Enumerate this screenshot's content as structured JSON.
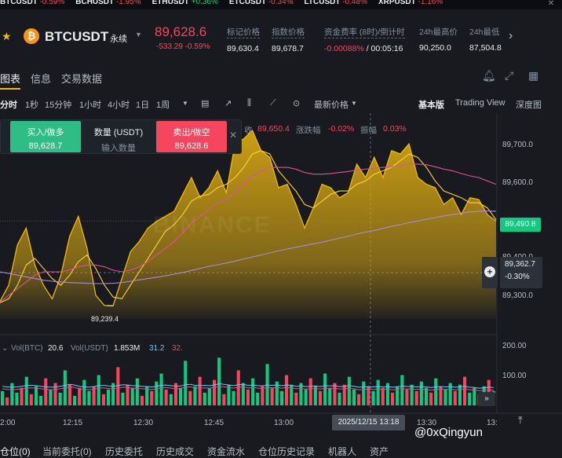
{
  "ticker": [
    {
      "sym": "BTCUSDT",
      "chg": "-0.59%",
      "dir": "neg"
    },
    {
      "sym": "BCHUSDT",
      "chg": "-1.95%",
      "dir": "neg"
    },
    {
      "sym": "ETHUSDT",
      "chg": "+0.36%",
      "dir": "pos"
    },
    {
      "sym": "ETCUSDT",
      "chg": "-0.34%",
      "dir": "neg"
    },
    {
      "sym": "LTCUSDT",
      "chg": "-0.48%",
      "dir": "neg"
    },
    {
      "sym": "XRPUSDT",
      "chg": "-1.16%",
      "dir": "neg"
    }
  ],
  "header": {
    "pair": "BTCUSDT",
    "perp": "永续",
    "price": "89,628.6",
    "change": "-533.29 -0.59%",
    "stats": [
      {
        "label": "标记价格",
        "value": "89,630.4"
      },
      {
        "label": "指数价格",
        "value": "89,678.7"
      },
      {
        "label": "资金费率 (8时)/倒计时",
        "value_neg": "-0.00088%",
        "value": " / 00:05:16"
      },
      {
        "label": "24h最高价",
        "value": "90,250.0"
      },
      {
        "label": "24h最低",
        "value": "87,504.8"
      }
    ]
  },
  "tabs": [
    "图表",
    "信息",
    "交易数据"
  ],
  "toolbar": {
    "intervals": [
      "分时",
      "1秒",
      "15分钟",
      "1小时",
      "4小时",
      "1日",
      "1周"
    ],
    "price_type": "最新价格",
    "views": [
      "基本版",
      "Trading View",
      "深度图"
    ]
  },
  "order_box": {
    "buy_label": "买入/做多",
    "buy_price": "89,628.7",
    "qty_label": "数量 (USDT)",
    "qty_placeholder": "输入数量",
    "sell_label": "卖出/做空",
    "sell_price": "89,628.6"
  },
  "ohlc": {
    "close_label": "收",
    "close": "89,650.4",
    "chg_label": "涨跌幅",
    "chg": "-0.02%",
    "amp_label": "振幅",
    "amp": "0.03%"
  },
  "watermark": "BINANCE",
  "price_axis": {
    "labels": [
      "89,700.0",
      "89,600.0",
      "89,400.0",
      "89,300.0"
    ],
    "current_tag": "89,490.8",
    "cross_tag": "89,362.7",
    "cross_pct": "-0.30%",
    "low_label": "89,239.4"
  },
  "volume": {
    "vol_btc_label": "Vol(BTC)",
    "vol_btc": "20.6",
    "vol_usdt_label": "Vol(USDT)",
    "vol_usdt": "1.853M",
    "ma1": "31.2",
    "ma2": "32.",
    "axis": [
      "200.00",
      "100.00"
    ]
  },
  "time_axis": {
    "labels": [
      "2:00",
      "12:15",
      "12:30",
      "12:45",
      "13:00",
      "13:30",
      "13:"
    ],
    "cross": "2025/12/15 13:18"
  },
  "bottom_tabs": [
    "仓位(0)",
    "当前委托(0)",
    "历史委托",
    "历史成交",
    "资金流水",
    "仓位历史记录",
    "机器人",
    "资产"
  ],
  "credit": "@0xQingyun",
  "colors": {
    "up": "#0ecb81",
    "down": "#f6465d",
    "accent": "#f0b90b",
    "area": "#d4a514"
  },
  "chart_data": {
    "type": "area",
    "y_range": [
      89200,
      89760
    ],
    "price": [
      89252,
      89300,
      89420,
      89470,
      89360,
      89300,
      89260,
      89330,
      89445,
      89505,
      89410,
      89270,
      89240,
      89239.4,
      89320,
      89400,
      89430,
      89470,
      89490,
      89505,
      89520,
      89570,
      89620,
      89560,
      89590,
      89640,
      89575,
      89720,
      89735,
      89760,
      89700,
      89680,
      89590,
      89600,
      89540,
      89470,
      89530,
      89600,
      89590,
      89560,
      89575,
      89660,
      89620,
      89680,
      89620,
      89700,
      89690,
      89720,
      89620,
      89600,
      89590,
      89540,
      89560,
      89510,
      89560,
      89555,
      89510,
      89490.8
    ],
    "ma_fast": [
      89248,
      89260,
      89300,
      89360,
      89380,
      89350,
      89320,
      89300,
      89330,
      89370,
      89390,
      89350,
      89300,
      89265,
      89260,
      89300,
      89340,
      89380,
      89420,
      89460,
      89480,
      89510,
      89550,
      89565,
      89570,
      89590,
      89600,
      89620,
      89650,
      89690,
      89700,
      89690,
      89640,
      89610,
      89580,
      89540,
      89530,
      89550,
      89570,
      89580,
      89580,
      89600,
      89610,
      89630,
      89640,
      89650,
      89670,
      89690,
      89680,
      89650,
      89610,
      89580,
      89570,
      89560,
      89545,
      89545,
      89530,
      89495
    ],
    "ma_mid": [
      89250,
      89270,
      89290,
      89310,
      89330,
      89340,
      89340,
      89340,
      89345,
      89355,
      89360,
      89360,
      89355,
      89345,
      89340,
      89345,
      89355,
      89370,
      89390,
      89410,
      89430,
      89455,
      89485,
      89505,
      89525,
      89545,
      89555,
      89575,
      89600,
      89625,
      89640,
      89650,
      89650,
      89650,
      89645,
      89635,
      89630,
      89630,
      89632,
      89635,
      89638,
      89642,
      89645,
      89648,
      89650,
      89652,
      89655,
      89660,
      89660,
      89658,
      89652,
      89645,
      89640,
      89632,
      89625,
      89620,
      89610,
      89600
    ],
    "ma_slow": [
      89340,
      89335,
      89330,
      89325,
      89320,
      89315,
      89312,
      89310,
      89308,
      89307,
      89306,
      89305,
      89305,
      89306,
      89308,
      89312,
      89316,
      89320,
      89324,
      89328,
      89333,
      89338,
      89344,
      89350,
      89356,
      89361,
      89366,
      89372,
      89378,
      89384,
      89390,
      89396,
      89402,
      89408,
      89413,
      89418,
      89423,
      89428,
      89434,
      89440,
      89446,
      89452,
      89458,
      89463,
      89469,
      89475,
      89480,
      89486,
      89491,
      89496,
      89501,
      89506,
      89510,
      89514,
      89518,
      89520,
      89521,
      89520
    ],
    "volume": [
      45,
      25,
      70,
      40,
      55,
      90,
      35,
      60,
      30,
      85,
      50,
      70,
      40,
      110,
      65,
      30,
      55,
      80,
      45,
      60,
      95,
      35,
      50,
      70,
      120,
      40,
      65,
      55,
      85,
      30,
      60,
      45,
      75,
      100,
      50,
      35,
      70,
      55,
      140,
      45,
      60,
      90,
      40,
      55,
      80,
      150,
      35,
      65,
      45,
      110,
      70,
      50,
      85,
      40,
      60,
      130,
      55,
      75,
      45,
      95,
      65,
      40,
      70,
      50,
      85,
      60,
      45,
      100,
      55,
      70,
      40,
      65,
      90,
      50,
      35,
      75,
      60,
      45,
      80,
      55,
      70,
      40,
      60,
      95,
      50,
      65,
      45,
      75,
      55,
      40,
      85,
      60,
      50,
      70,
      45,
      65,
      90,
      40,
      55,
      35,
      60,
      80,
      45
    ],
    "vol_ma": [
      60,
      58,
      57,
      58,
      60,
      62,
      63,
      62,
      60,
      58,
      57,
      58,
      60,
      63,
      66,
      64,
      60,
      58,
      57,
      59,
      62,
      63,
      61,
      60,
      62,
      65,
      64,
      62,
      61,
      60,
      59,
      58,
      60,
      63,
      64,
      62,
      60,
      61,
      65,
      66,
      63,
      62,
      63,
      62,
      64,
      68,
      66,
      64,
      62,
      65,
      66,
      63,
      64,
      62,
      61,
      64,
      63,
      64,
      62,
      64,
      63,
      60,
      61,
      59,
      60,
      61,
      59,
      62,
      61,
      62,
      59,
      60,
      62,
      60,
      57,
      58,
      59,
      58,
      59,
      58,
      59,
      57,
      58,
      61,
      59,
      60,
      58,
      59,
      58,
      56,
      58,
      59,
      58,
      59,
      57,
      58,
      60,
      57,
      56,
      54,
      55,
      57,
      56
    ]
  }
}
